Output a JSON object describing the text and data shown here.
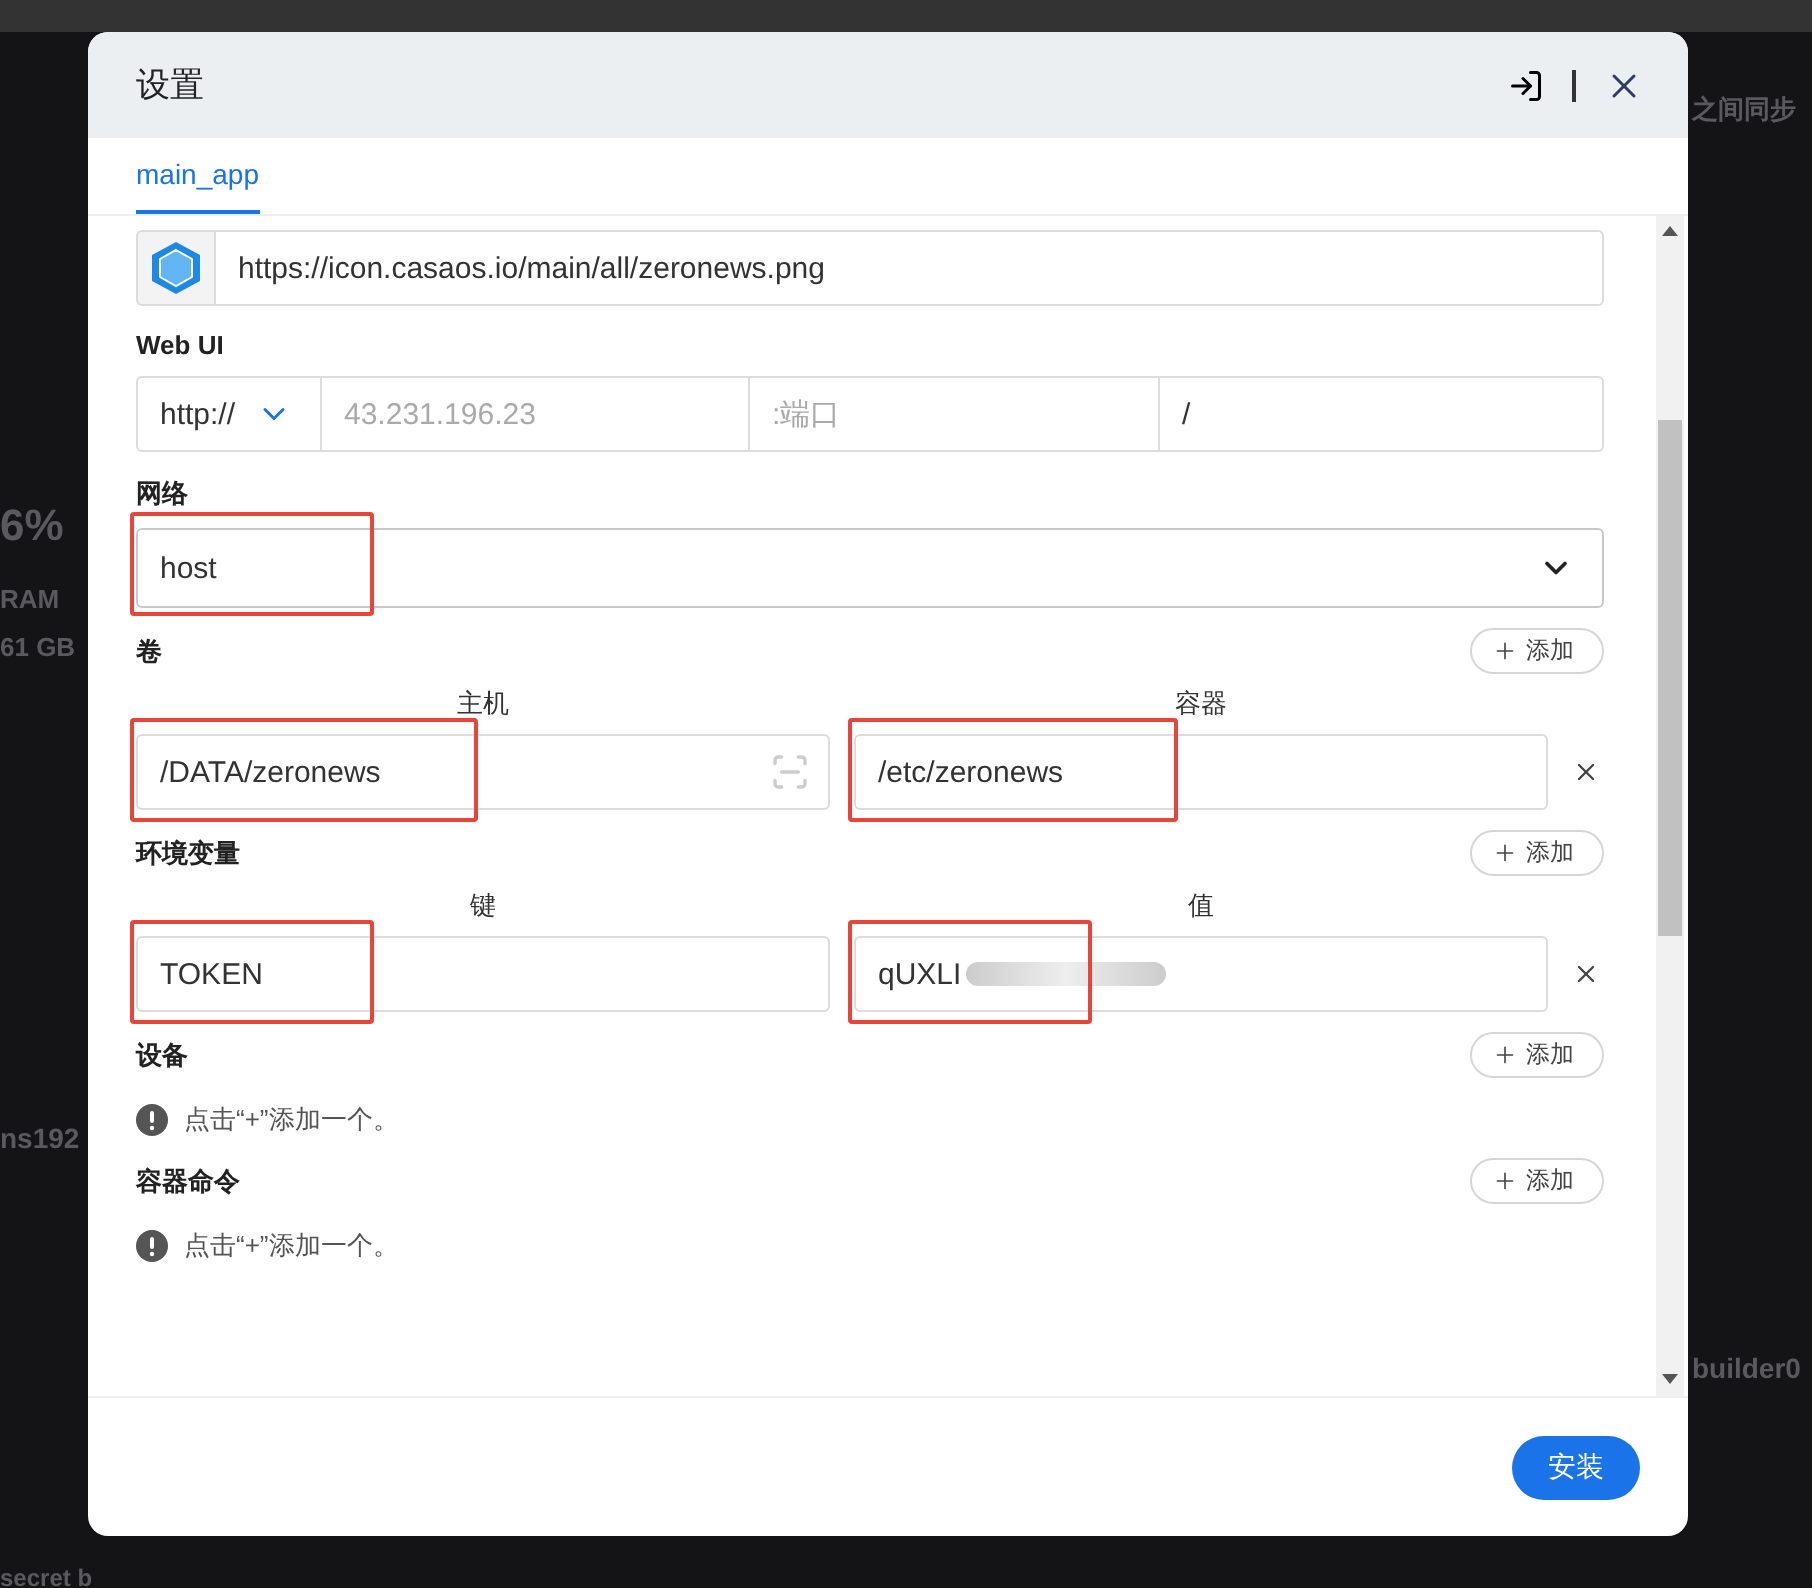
{
  "backdrop": {
    "fragments": [
      {
        "kind": "top-right",
        "text": "之间同步"
      },
      {
        "kind": "gauge",
        "text": "6%"
      },
      {
        "kind": "ram",
        "text": "RAM"
      },
      {
        "kind": "size",
        "text": "61 GB"
      },
      {
        "kind": "name",
        "text": "ns192"
      },
      {
        "kind": "builder",
        "text": "builder0"
      },
      {
        "kind": "bottom",
        "text": "secret b"
      }
    ]
  },
  "dialog": {
    "title": "设置",
    "tabs": [
      {
        "label": "main_app",
        "selected": true
      }
    ],
    "icon_url": {
      "value": "https://icon.casaos.io/main/all/zeronews.png"
    },
    "web_ui": {
      "label": "Web UI",
      "scheme": "http://",
      "host_placeholder": "43.231.196.23",
      "port_placeholder": ":端口",
      "path": "/"
    },
    "network": {
      "label": "网络",
      "value": "host",
      "highlighted": true
    },
    "sections": [
      {
        "kind": "pairs",
        "label": "卷",
        "add": "添加",
        "headings": [
          "主机",
          "容器"
        ],
        "rows": [
          {
            "left": {
              "value": "/DATA/zeronews",
              "highlighted": true,
              "browse": true
            },
            "right": {
              "value": "/etc/zeronews",
              "highlighted": true,
              "browse": false
            }
          }
        ]
      },
      {
        "kind": "pairs",
        "label": "环境变量",
        "add": "添加",
        "headings": [
          "键",
          "值"
        ],
        "rows": [
          {
            "left": {
              "value": "TOKEN",
              "highlighted": true,
              "browse": false
            },
            "right": {
              "value": "qUXLI",
              "highlighted": true,
              "browse": false,
              "redacted": true
            }
          }
        ]
      },
      {
        "kind": "empty",
        "label": "设备",
        "add": "添加",
        "hint": "点击“+”添加一个。"
      },
      {
        "kind": "empty",
        "label": "容器命令",
        "add": "添加",
        "hint": "点击“+”添加一个。"
      }
    ],
    "install": "安装"
  }
}
